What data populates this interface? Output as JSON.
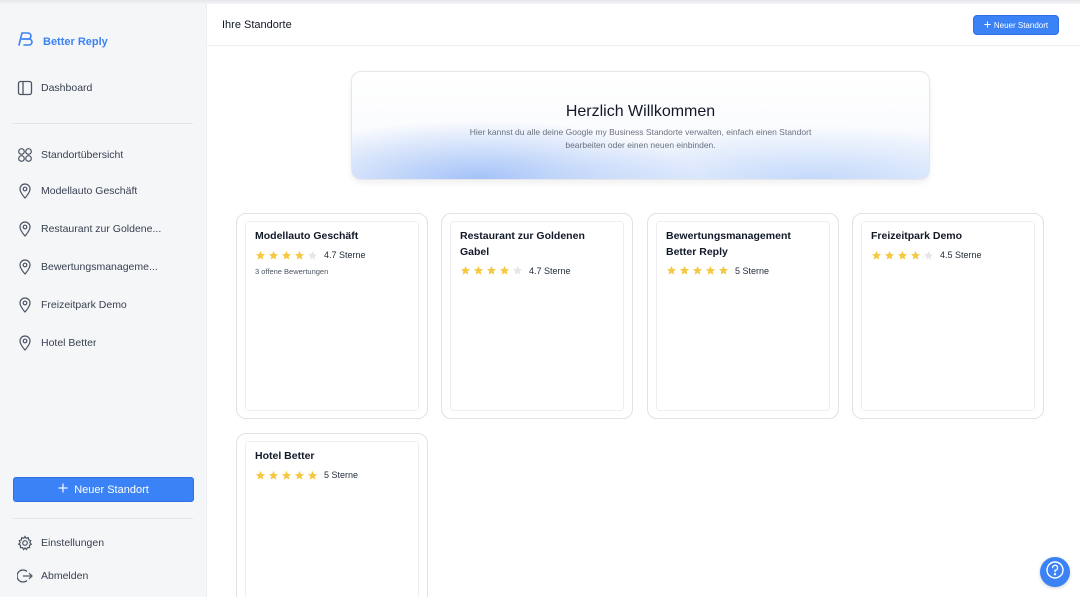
{
  "brand": {
    "name": "Better Reply"
  },
  "sidebar": {
    "dashboard": "Dashboard",
    "overview": "Standortübersicht",
    "locations": [
      "Modellauto Geschäft",
      "Restaurant zur Goldene...",
      "Bewertungsmanageme...",
      "Freizeitpark Demo",
      "Hotel Better"
    ],
    "new_location": "Neuer Standort",
    "settings": "Einstellungen",
    "logout": "Abmelden"
  },
  "header": {
    "title": "Ihre Standorte",
    "new_location": "Neuer Standort"
  },
  "welcome": {
    "title": "Herzlich Willkommen",
    "text": "Hier kannst du alle deine Google my Business Standorte verwalten, einfach einen Standort bearbeiten oder einen neuen einbinden."
  },
  "cards": [
    {
      "name": "Modellauto Geschäft",
      "stars": 4,
      "rating": "4.7 Sterne",
      "open_reviews": "3 offene Bewertungen"
    },
    {
      "name": "Restaurant zur Goldenen Gabel",
      "stars": 4,
      "rating": "4.7 Sterne",
      "open_reviews": ""
    },
    {
      "name": "Bewertungsmanagement Better Reply",
      "stars": 5,
      "rating": "5 Sterne",
      "open_reviews": ""
    },
    {
      "name": "Freizeitpark Demo",
      "stars": 4,
      "rating": "4.5 Sterne",
      "open_reviews": ""
    },
    {
      "name": "Hotel Better",
      "stars": 5,
      "rating": "5 Sterne",
      "open_reviews": ""
    }
  ],
  "colors": {
    "accent": "#3b82f6",
    "star_filled": "#f5c842",
    "star_empty": "#e5e7eb"
  }
}
